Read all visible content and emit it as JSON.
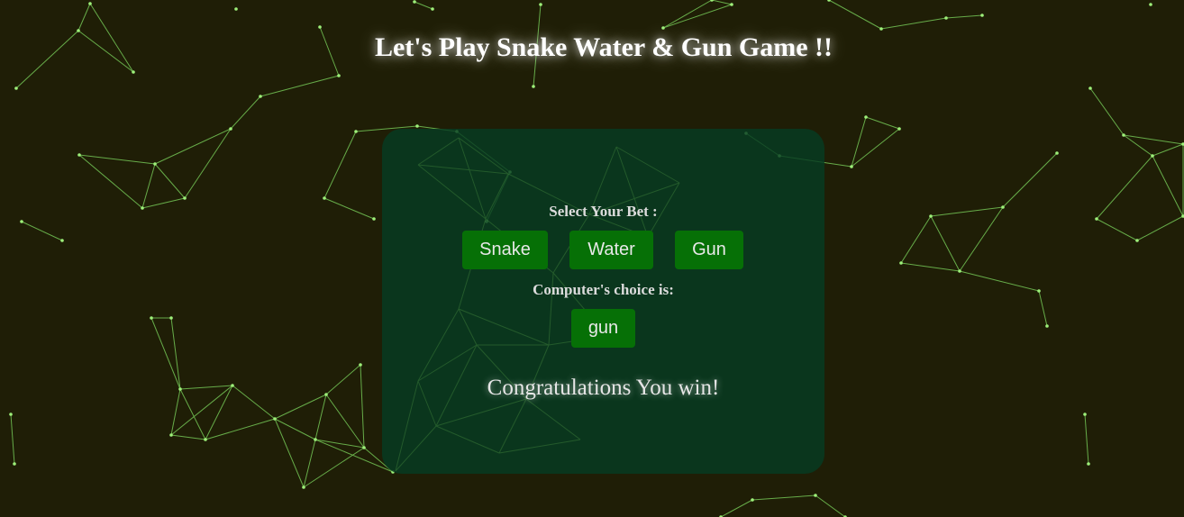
{
  "page": {
    "title": "Let's Play Snake Water & Gun Game !!"
  },
  "game": {
    "select_label": "Select Your Bet :",
    "bets": [
      "Snake",
      "Water",
      "Gun"
    ],
    "computer_label": "Computer's choice is:",
    "computer_choice": "gun",
    "result": "Congratulations You win!"
  },
  "colors": {
    "background": "#1f1e06",
    "card": "#0d3a21",
    "button": "#067006",
    "network_lines": "#7fdc60"
  },
  "icons": {
    "background": "network-lines-decoration"
  }
}
